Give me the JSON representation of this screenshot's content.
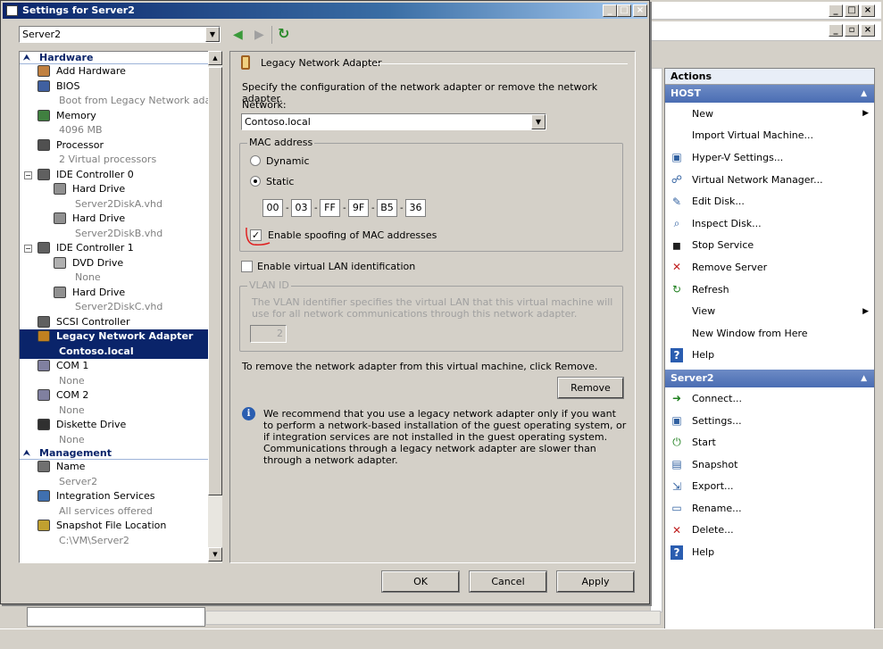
{
  "dialog": {
    "title": "Settings for Server2",
    "server_combo": "Server2"
  },
  "tree": {
    "hardware_label": "Hardware",
    "management_label": "Management",
    "items": [
      {
        "label": "Add Hardware",
        "sub": ""
      },
      {
        "label": "BIOS",
        "sub": "Boot from Legacy Network ada..."
      },
      {
        "label": "Memory",
        "sub": "4096 MB"
      },
      {
        "label": "Processor",
        "sub": "2 Virtual processors"
      },
      {
        "label": "IDE Controller 0",
        "sub": ""
      },
      {
        "label": "Hard Drive",
        "sub": "Server2DiskA.vhd"
      },
      {
        "label": "Hard Drive",
        "sub": "Server2DiskB.vhd"
      },
      {
        "label": "IDE Controller 1",
        "sub": ""
      },
      {
        "label": "DVD Drive",
        "sub": "None"
      },
      {
        "label": "Hard Drive",
        "sub": "Server2DiskC.vhd"
      },
      {
        "label": "SCSI Controller",
        "sub": ""
      },
      {
        "label": "Legacy Network Adapter",
        "sub": "Contoso.local"
      },
      {
        "label": "COM 1",
        "sub": "None"
      },
      {
        "label": "COM 2",
        "sub": "None"
      },
      {
        "label": "Diskette Drive",
        "sub": "None"
      }
    ],
    "mgmt_items": [
      {
        "label": "Name",
        "sub": "Server2"
      },
      {
        "label": "Integration Services",
        "sub": "All services offered"
      },
      {
        "label": "Snapshot File Location",
        "sub": "C:\\VM\\Server2"
      }
    ]
  },
  "panel": {
    "heading": "Legacy Network Adapter",
    "description": "Specify the configuration of the network adapter or remove the network adapter.",
    "network_label": "Network:",
    "network_value": "Contoso.local",
    "mac_group": "MAC address",
    "dynamic_label": "Dynamic",
    "static_label": "Static",
    "mac": [
      "00",
      "03",
      "FF",
      "9F",
      "B5",
      "36"
    ],
    "spoof_label": "Enable spoofing of MAC addresses",
    "vlan_check_label": "Enable virtual LAN identification",
    "vlan_group": "VLAN ID",
    "vlan_desc": "The VLAN identifier specifies the virtual LAN that this virtual machine will use for all network communications through this network adapter.",
    "vlan_value": "2",
    "remove_text": "To remove the network adapter from this virtual machine, click Remove.",
    "remove_button": "Remove",
    "info_text": "We recommend that you use a legacy network adapter only if you want to perform a network-based installation of the guest operating system, or if integration services are not installed in the guest operating system. Communications through a legacy network adapter are slower than through a network adapter."
  },
  "buttons": {
    "ok": "OK",
    "cancel": "Cancel",
    "apply": "Apply"
  },
  "actions": {
    "title": "Actions",
    "host_section": "HOST",
    "host_items": [
      "New",
      "Import Virtual Machine...",
      "Hyper-V Settings...",
      "Virtual Network Manager...",
      "Edit Disk...",
      "Inspect Disk...",
      "Stop Service",
      "Remove Server",
      "Refresh",
      "View",
      "New Window from Here",
      "Help"
    ],
    "server_section": "Server2",
    "server_items": [
      "Connect...",
      "Settings...",
      "Start",
      "Snapshot",
      "Export...",
      "Rename...",
      "Delete...",
      "Help"
    ]
  },
  "colors": {
    "selection": "#0a246a",
    "actions_header": "#4a6db3",
    "annotation": "#e02020"
  }
}
